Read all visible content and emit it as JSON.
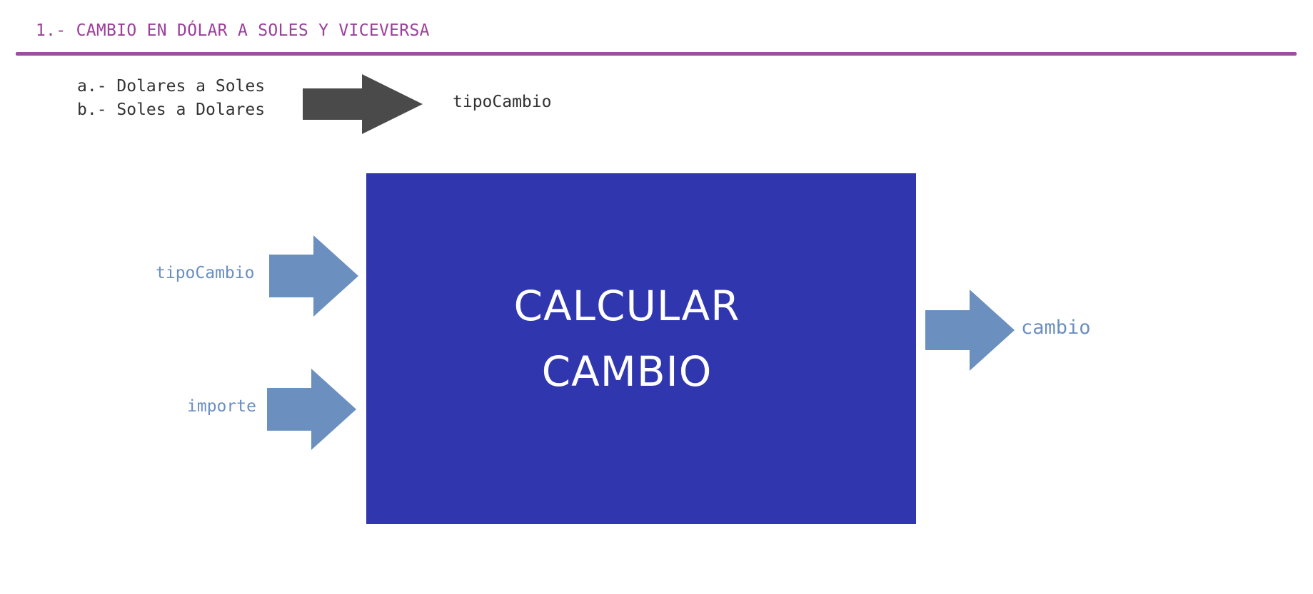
{
  "header": {
    "title": "1.- CAMBIO EN DÓLAR A SOLES Y VICEVERSA"
  },
  "options": {
    "a": "a.- Dolares a Soles",
    "b": "b.- Soles a Dolares",
    "output": "tipoCambio"
  },
  "process": {
    "line1": "CALCULAR",
    "line2": "CAMBIO"
  },
  "inputs": [
    {
      "label": "tipoCambio"
    },
    {
      "label": "importe"
    }
  ],
  "output": {
    "label": "cambio"
  },
  "colors": {
    "title": "#9b3f9b",
    "rule": "#9b4f9d",
    "dark_arrow": "#4a4a4a",
    "box": "#3036ae",
    "io_arrow": "#6b8fbf",
    "io_text": "#6b8fbf",
    "box_text": "#ffffff"
  }
}
